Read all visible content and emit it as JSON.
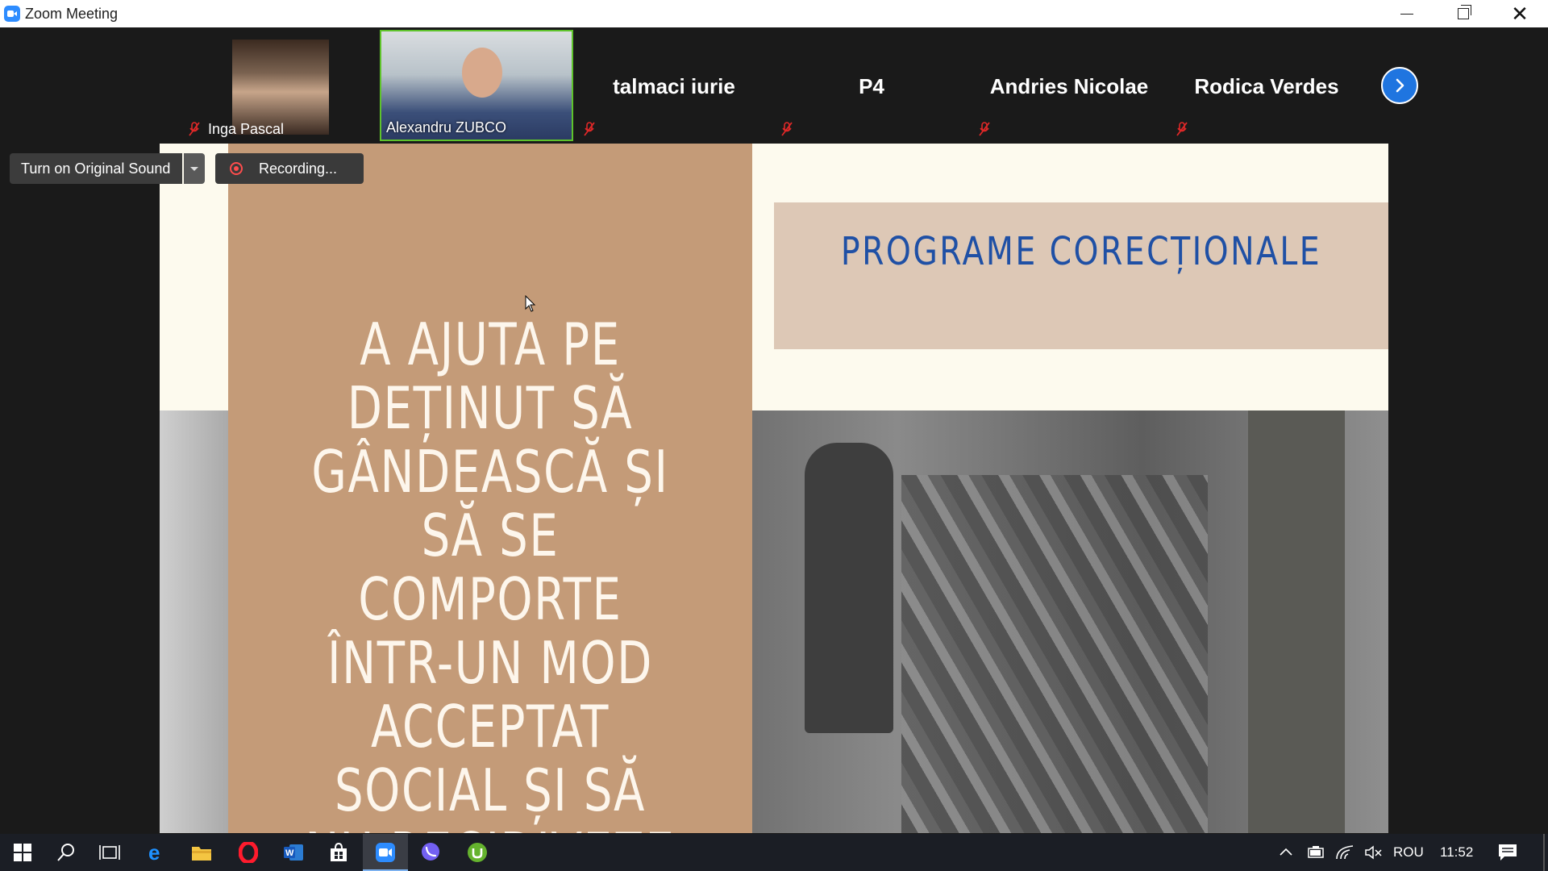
{
  "window": {
    "title": "Zoom Meeting"
  },
  "gallery": {
    "participants": [
      {
        "name": "Inga Pascal",
        "muted": true,
        "has_video": true
      },
      {
        "name": "Alexandru ZUBCO",
        "muted": false,
        "has_video": true,
        "active_speaker": true
      },
      {
        "name": "talmaci iurie",
        "muted": true,
        "has_video": false
      },
      {
        "name": "P4",
        "muted": true,
        "has_video": false
      },
      {
        "name": "Andries Nicolae",
        "muted": true,
        "has_video": false
      },
      {
        "name": "Rodica Verdes",
        "muted": true,
        "has_video": false
      }
    ],
    "next_page_icon": "chevron-right-icon"
  },
  "controls": {
    "original_sound_label": "Turn on Original Sound",
    "recording_label": "Recording..."
  },
  "slide": {
    "title": "PROGRAME CORECȚIONALE",
    "quote": "A AJUTA PE DEȚINUT SĂ GÂNDEASCĂ ȘI SĂ SE COMPORTE ÎNTR-UN MOD ACCEPTAT SOCIAL ȘI SĂ NU RECIDIVEZE"
  },
  "taskbar": {
    "apps": [
      "start-icon",
      "search-icon",
      "task-view-icon",
      "edge-icon",
      "file-explorer-icon",
      "opera-icon",
      "word-icon",
      "store-icon",
      "zoom-icon",
      "viber-icon",
      "utorrent-icon"
    ],
    "active_app": "zoom-icon",
    "language": "ROU",
    "time": "11:52"
  },
  "colors": {
    "active_speaker_border": "#5ec32b",
    "slide_panel": "#c49b78",
    "slide_title": "#1f50a5",
    "recording_dot": "#ff4d4d",
    "next_button": "#1f75e0"
  }
}
